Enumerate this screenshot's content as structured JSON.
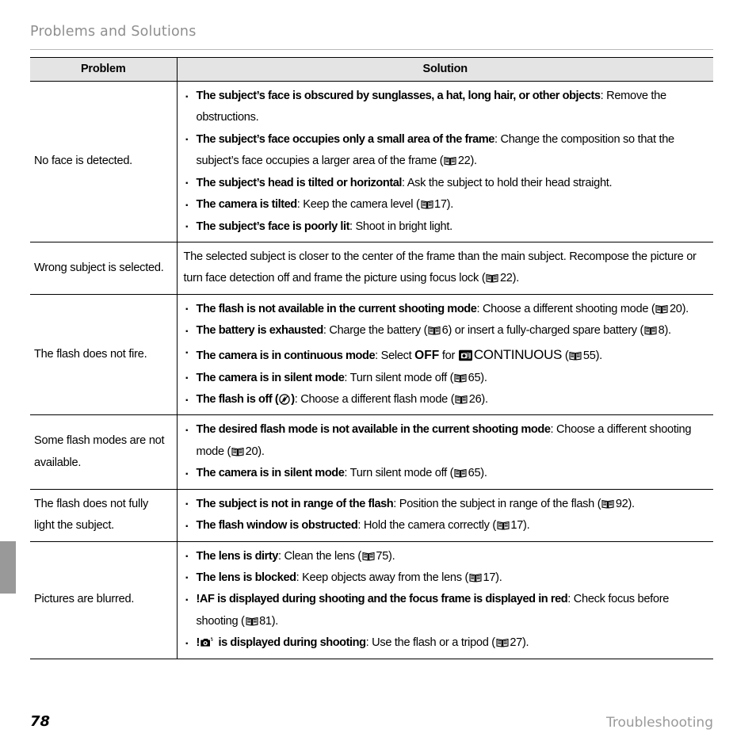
{
  "header": {
    "title": "Problems and Solutions"
  },
  "table": {
    "columns": [
      "Problem",
      "Solution"
    ],
    "rows": [
      {
        "problem": "No face is detected.",
        "type": "bullets",
        "items": [
          {
            "lead": "The subject’s face is obscured by sunglasses, a hat, long hair, or other objects",
            "rest": ": Remove the obstructions."
          },
          {
            "lead": "The subject’s face occupies only a small area of the frame",
            "rest": ": Change the composition so that the subject’s face occupies a larger area of the frame (",
            "ref": "22",
            "tail": ")."
          },
          {
            "lead": "The subject’s head is tilted or horizontal",
            "rest": ": Ask the subject to hold their head straight."
          },
          {
            "lead": "The camera is tilted",
            "rest": ": Keep the camera level (",
            "ref": "17",
            "tail": ")."
          },
          {
            "lead": "The subject’s face is poorly lit",
            "rest": ": Shoot in bright light."
          }
        ]
      },
      {
        "problem": "Wrong subject is selected.",
        "type": "paragraph",
        "text_before": "The selected subject is closer to the center of the frame than the main subject.  Recompose the picture or turn face detection off and frame the picture using focus lock (",
        "ref": "22",
        "text_after": ")."
      },
      {
        "problem": "The flash does not fire.",
        "type": "bullets",
        "items": [
          {
            "lead": "The flash is not available in the current shooting mode",
            "rest": ": Choose a different shooting mode (",
            "ref": "20",
            "tail": ")."
          },
          {
            "lead": "The battery is exhausted",
            "rest": ": Charge the battery (",
            "ref": "6",
            "mid": ") or insert a fully-charged spare battery (",
            "ref2": "8",
            "tail": ")."
          },
          {
            "lead": "The camera is in continuous mode",
            "rest": ": Select ",
            "strong_off": "OFF",
            "rest2": " for ",
            "icon": "continuous-icon",
            "caps": "CONTINUOUS",
            "paren_open": " (",
            "ref": "55",
            "tail": ")."
          },
          {
            "lead": "The camera is in silent mode",
            "rest": ": Turn silent mode off (",
            "ref": "65",
            "tail": ")."
          },
          {
            "lead_a": "The flash is off (",
            "icon": "flash-off-icon",
            "lead_b": ")",
            "rest": ": Choose a different flash mode (",
            "ref": "26",
            "tail": ")."
          }
        ]
      },
      {
        "problem": "Some flash modes are not available.",
        "type": "bullets",
        "items": [
          {
            "lead": "The desired flash mode is not available in the current shooting mode",
            "rest": ": Choose a different shooting mode (",
            "ref": "20",
            "tail": ")."
          },
          {
            "lead": "The camera is in silent mode",
            "rest": ": Turn silent mode off (",
            "ref": "65",
            "tail": ")."
          }
        ]
      },
      {
        "problem": "The flash does not fully light the subject.",
        "type": "bullets",
        "items": [
          {
            "lead": "The subject is not in range of the flash",
            "rest": ": Position the subject in range of the flash (",
            "ref": "92",
            "tail": ")."
          },
          {
            "lead": "The flash window is obstructed",
            "rest": ": Hold the camera correctly (",
            "ref": "17",
            "tail": ")."
          }
        ]
      },
      {
        "problem": "Pictures are blurred.",
        "type": "bullets",
        "items": [
          {
            "lead": "The lens is dirty",
            "rest": ": Clean the lens (",
            "ref": "75",
            "tail": ")."
          },
          {
            "lead": "The lens is blocked",
            "rest": ": Keep objects away from the lens (",
            "ref": "17",
            "tail": ")."
          },
          {
            "bang": "!",
            "lead": "AF is displayed during shooting and the focus frame is displayed in red",
            "rest": ": Check focus before shooting (",
            "ref": "81",
            "tail": ")."
          },
          {
            "bang": "!",
            "icon": "camera-shake-icon",
            "lead": " is displayed during shooting",
            "rest": ": Use the flash or a tripod (",
            "ref": "27",
            "tail": ")."
          }
        ]
      }
    ]
  },
  "footer": {
    "page_number": "78",
    "section": "Troubleshooting"
  },
  "colors": {
    "header_text": "#8f8f8f",
    "table_header_bg": "#e4e4e4",
    "side_tab": "#999999",
    "rule": "#b9b9b9",
    "body_text": "#000000"
  }
}
